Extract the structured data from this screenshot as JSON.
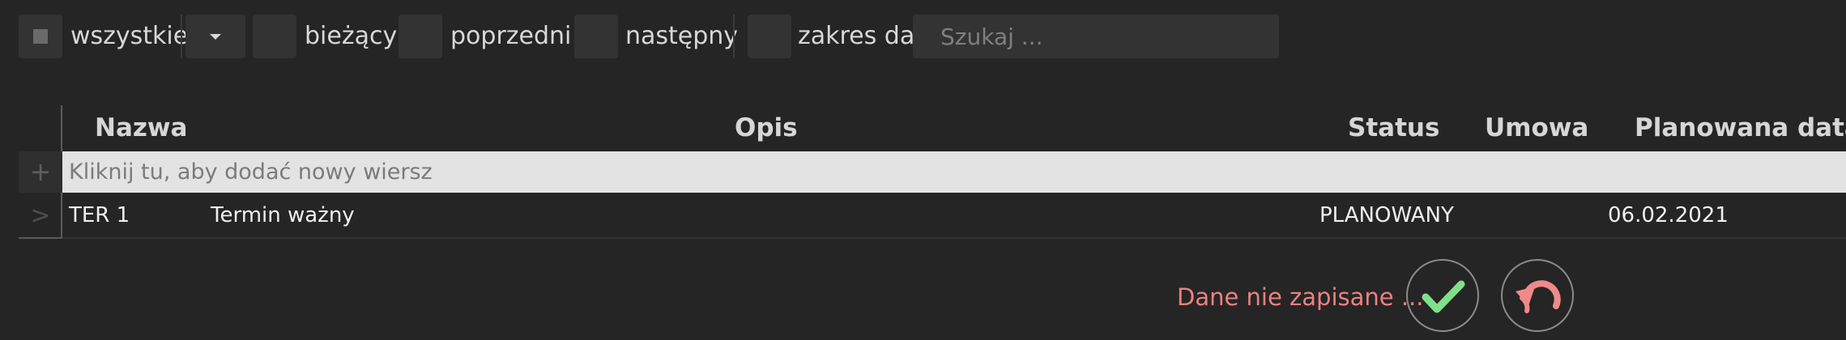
{
  "toolbar": {
    "all_label": "wszystkie",
    "current_label": "bieżący",
    "previous_label": "poprzedni",
    "next_label": "następny",
    "date_range_label": "zakres dat",
    "search_placeholder": "Szukaj ...",
    "search_value": ""
  },
  "grid": {
    "columns": [
      "Nazwa",
      "Opis",
      "Status",
      "Umowa",
      "Planowana data"
    ],
    "add_row_prompt": "Kliknij tu, aby dodać nowy wiersz",
    "add_row_icon": "plus-icon",
    "row_indicator_icon": "chevron-right-icon",
    "rows": [
      {
        "nazwa": "TER 1",
        "opis": "Termin ważny",
        "status": "PLANOWANY",
        "umowa": "",
        "planowana_data": "06.02.2021"
      }
    ]
  },
  "footer": {
    "unsaved_text": "Dane nie zapisane ...",
    "confirm_icon": "checkmark-icon",
    "undo_icon": "undo-icon"
  },
  "colors": {
    "background": "#252525",
    "unsaved_text": "#ee8080",
    "confirm": "#7fe08a",
    "undo": "#f08a8a"
  }
}
